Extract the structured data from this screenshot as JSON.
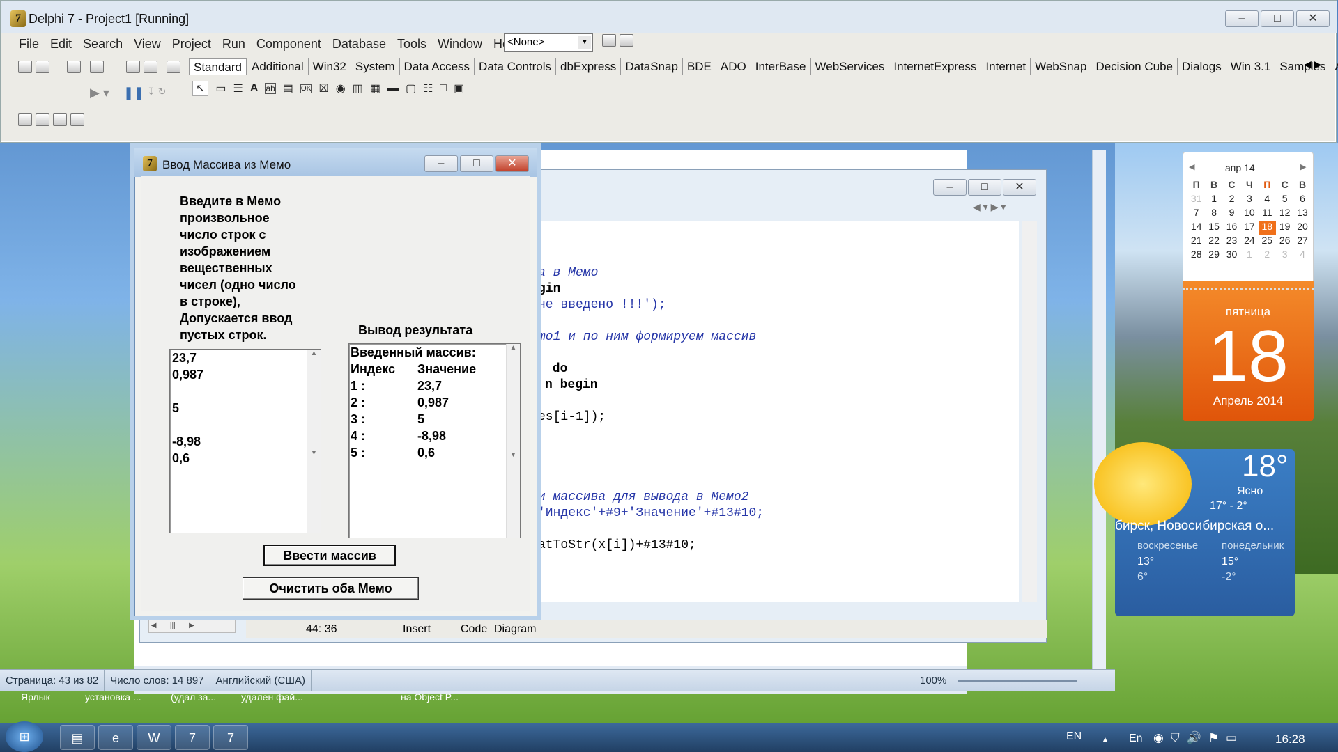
{
  "delphi": {
    "title": "Delphi 7 - Project1 [Running]",
    "menu": [
      "File",
      "Edit",
      "Search",
      "View",
      "Project",
      "Run",
      "Component",
      "Database",
      "Tools",
      "Window",
      "Help"
    ],
    "combo_value": "<None>",
    "palette_tabs": [
      "Standard",
      "Additional",
      "Win32",
      "System",
      "Data Access",
      "Data Controls",
      "dbExpress",
      "DataSnap",
      "BDE",
      "ADO",
      "InterBase",
      "WebServices",
      "InternetExpress",
      "Internet",
      "WebSnap",
      "Decision Cube",
      "Dialogs",
      "Win 3.1",
      "Samples",
      "A"
    ]
  },
  "form": {
    "title": "Ввод Массива из Мемо",
    "instruction_lines": [
      "Введите в Мемо",
      "произвольное",
      "число строк с",
      "изображением",
      "вещественных",
      "чисел  (одно число",
      "в строке),",
      "Допускается ввод",
      "пустых строк."
    ],
    "output_label": "Вывод результата",
    "memo1_lines": [
      "23,7",
      "0,987",
      "",
      "5",
      "",
      "-8,98",
      "0,6"
    ],
    "memo2_header": "Введенный массив:",
    "memo2_col_index": "Индекс",
    "memo2_col_value": "Значение",
    "memo2_rows": [
      {
        "i": "1 :",
        "v": "23,7"
      },
      {
        "i": "2 :",
        "v": "0,987"
      },
      {
        "i": "3 :",
        "v": "5"
      },
      {
        "i": "4 :",
        "v": "-8,98"
      },
      {
        "i": "5 :",
        "v": "0,6"
      }
    ],
    "btn_input": "Ввести массив",
    "btn_clear": "Очистить оба Мемо"
  },
  "editor": {
    "code_lines": [
      {
        "text": "а в Мемо",
        "cls": "cmt"
      },
      {
        "text": "gin",
        "cls": "kw"
      },
      {
        "text": "не введено !!!');",
        "cls": "str"
      },
      {
        "text": "mo1 и по ним формируем массив",
        "cls": "cmt"
      },
      {
        "text": " do",
        "cls": "kw"
      },
      {
        "text": "n begin",
        "cls": "kw"
      },
      {
        "text": "es[i-1]);",
        "cls": ""
      },
      {
        "text": "и массива для вывода в Мемо2",
        "cls": "cmt"
      },
      {
        "text": "'Индекс'+#9+'Значение'+#13#10;",
        "cls": "str"
      },
      {
        "text": "atToStr(x[i])+#13#10;",
        "cls": ""
      }
    ],
    "status_pos": "44:  36",
    "status_mode": "Insert",
    "tab_code": "Code",
    "tab_diagram": "Diagram"
  },
  "word_status": {
    "page": "Страница: 43 из 82",
    "words": "Число слов: 14 897",
    "lang": "Английский (США)",
    "zoom": "100%"
  },
  "calendar": {
    "month": "апр 14",
    "weekdays": [
      "П",
      "В",
      "С",
      "Ч",
      "П",
      "С",
      "В"
    ],
    "weeks": [
      [
        "31",
        "1",
        "2",
        "3",
        "4",
        "5",
        "6"
      ],
      [
        "7",
        "8",
        "9",
        "10",
        "11",
        "12",
        "13"
      ],
      [
        "14",
        "15",
        "16",
        "17",
        "18",
        "19",
        "20"
      ],
      [
        "21",
        "22",
        "23",
        "24",
        "25",
        "26",
        "27"
      ],
      [
        "28",
        "29",
        "30",
        "1",
        "2",
        "3",
        "4"
      ]
    ],
    "day_name": "пятница",
    "day": "18",
    "month_year": "Апрель 2014"
  },
  "weather": {
    "temp": "18°",
    "cond": "Ясно",
    "range": "17°  -   2°",
    "city": "бирск, Новосибирская о...",
    "d1_name": "воскресенье",
    "d1_hi": "13°",
    "d1_lo": "6°",
    "d2_name": "понедельник",
    "d2_hi": "15°",
    "d2_lo": "-2°"
  },
  "desktop_labels": [
    "Ярлык",
    "установка ...",
    "(удал за...",
    "удален фай...",
    "на Object P..."
  ],
  "taskbar": {
    "lang": "EN",
    "lang2": "En",
    "clock": "16:28"
  }
}
